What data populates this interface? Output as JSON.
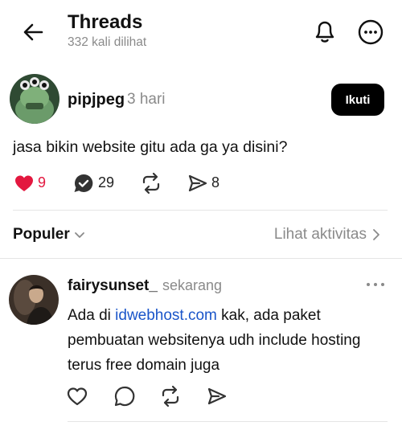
{
  "header": {
    "title": "Threads",
    "views": "332 kali dilihat",
    "icons": [
      "back-arrow-icon",
      "bell-icon",
      "more-circle-icon"
    ]
  },
  "post": {
    "author": "pipjpeg",
    "time": "3 hari",
    "follow_label": "Ikuti",
    "text": "jasa bikin website gitu ada ga ya disini?",
    "likes": "9",
    "replies": "29",
    "shares": "8",
    "like_color": "#e3183f"
  },
  "sort": {
    "label": "Populer",
    "activity_label": "Lihat aktivitas"
  },
  "reply": {
    "author": "fairysunset_",
    "time": "sekarang",
    "text_before": "Ada di ",
    "link": "idwebhost.com",
    "text_after": " kak, ada paket pembuatan websitenya udh include hosting terus free domain juga",
    "link_color": "#1a55c9"
  }
}
